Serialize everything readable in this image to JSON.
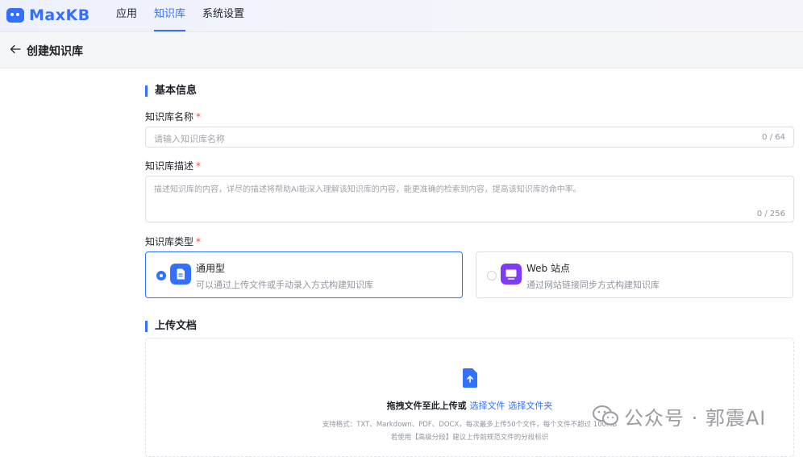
{
  "nav": {
    "brand": "MaxKB",
    "items": [
      {
        "label": "应用"
      },
      {
        "label": "知识库"
      },
      {
        "label": "系统设置"
      }
    ]
  },
  "subheader": {
    "title": "创建知识库"
  },
  "basic": {
    "section_title": "基本信息",
    "name": {
      "label": "知识库名称",
      "required": "*",
      "placeholder": "请输入知识库名称",
      "count": "0 / 64"
    },
    "desc": {
      "label": "知识库描述",
      "required": "*",
      "placeholder": "描述知识库的内容，详尽的描述将帮助AI能深入理解该知识库的内容，能更准确的检索到内容，提高该知识库的命中率。",
      "count": "0 / 256"
    },
    "type": {
      "label": "知识库类型",
      "required": "*",
      "options": [
        {
          "name": "通用型",
          "desc": "可以通过上传文件或手动录入方式构建知识库",
          "selected": true,
          "icon": "document-icon",
          "color": "#3370ff"
        },
        {
          "name": "Web 站点",
          "desc": "通过网站链接同步方式构建知识库",
          "selected": false,
          "icon": "monitor-icon",
          "color": "#7f3bf5"
        }
      ]
    }
  },
  "upload": {
    "section_title": "上传文档",
    "drop_text": "拖拽文件至此上传或",
    "select_file": "选择文件",
    "select_folder": "选择文件夹",
    "hint1": "支持格式：TXT、Markdown、PDF、DOCX，每次最多上传50个文件，每个文件不超过 100MB",
    "hint2": "若使用【高级分段】建议上传前规范文件的分段标识"
  },
  "watermark": {
    "text": "公众号 · 郭震AI"
  },
  "colors": {
    "accent": "#3370ff",
    "required": "#f54a45",
    "web_icon": "#7f3bf5"
  }
}
